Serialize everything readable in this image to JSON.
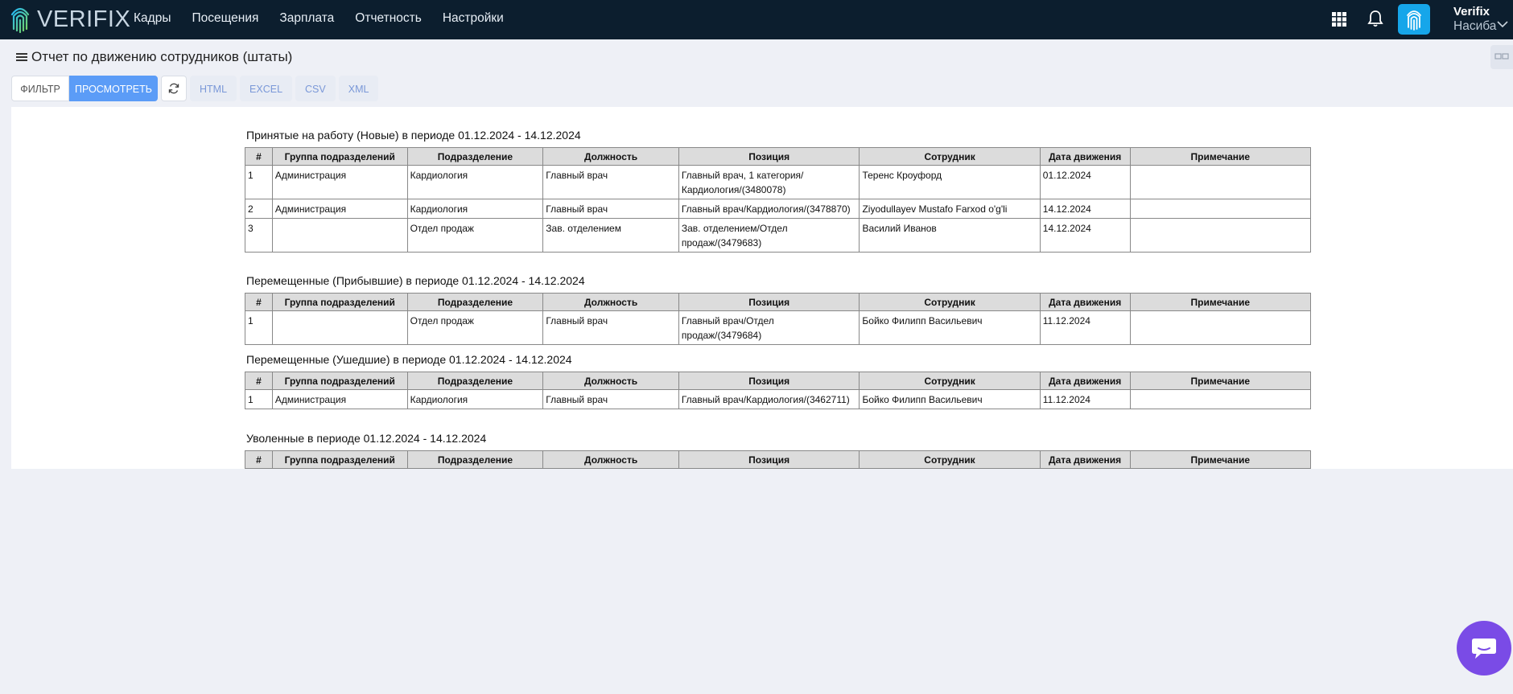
{
  "app": {
    "logo_text": "VERIFIX"
  },
  "nav": [
    {
      "label": "Кадры"
    },
    {
      "label": "Посещения"
    },
    {
      "label": "Зарплата"
    },
    {
      "label": "Отчетность"
    },
    {
      "label": "Настройки"
    }
  ],
  "user": {
    "company": "Verifix",
    "name": "Насиба"
  },
  "page": {
    "title": "Отчет по движению сотрудников (штаты)"
  },
  "toolbar": {
    "filter_label": "ФИЛЬТР",
    "view_label": "ПРОСМОТРЕТЬ",
    "formats": [
      "HTML",
      "EXCEL",
      "CSV",
      "XML"
    ]
  },
  "columns": [
    "#",
    "Группа подразделений",
    "Подразделение",
    "Должность",
    "Позиция",
    "Сотрудник",
    "Дата движения",
    "Примечание"
  ],
  "sections": [
    {
      "title": "Принятые на работу (Новые) в периоде 01.12.2024 - 14.12.2024",
      "rows": [
        [
          "1",
          "Администрация",
          "Кардиология",
          "Главный врач",
          "Главный врач, 1 категория/ Кардиология/(3480078)",
          "Теренс Кроуфорд",
          "01.12.2024",
          ""
        ],
        [
          "2",
          "Администрация",
          "Кардиология",
          "Главный врач",
          "Главный врач/Кардиология/(3478870)",
          "Ziyodullayev Mustafo Farxod o'g'li",
          "14.12.2024",
          ""
        ],
        [
          "3",
          "",
          "Отдел продаж",
          "Зав. отделением",
          "Зав. отделением/Отдел продаж/(3479683)",
          "Василий Иванов",
          "14.12.2024",
          ""
        ]
      ]
    },
    {
      "title": "Перемещенные (Прибывшие) в периоде 01.12.2024 - 14.12.2024",
      "rows": [
        [
          "1",
          "",
          "Отдел продаж",
          "Главный врач",
          "Главный врач/Отдел продаж/(3479684)",
          "Бойко Филипп Васильевич",
          "11.12.2024",
          ""
        ]
      ]
    },
    {
      "title": "Перемещенные (Ушедшие) в периоде 01.12.2024 - 14.12.2024",
      "rows": [
        [
          "1",
          "Администрация",
          "Кардиология",
          "Главный врач",
          "Главный врач/Кардиология/(3462711)",
          "Бойко Филипп Васильевич",
          "11.12.2024",
          ""
        ]
      ]
    },
    {
      "title": "Уволенные в периоде 01.12.2024 - 14.12.2024",
      "rows": []
    }
  ],
  "icons": {
    "apps": "apps-grid-icon",
    "notifications": "bell-icon",
    "fingerprint": "fingerprint-icon",
    "chat": "chat-icon"
  },
  "colors": {
    "topbar": "#0c1e2e",
    "accent": "#5b9cf7",
    "fingerprint_button": "#16a6ea",
    "chat_button": "#7a4be6",
    "page_bg": "#eef0f6"
  }
}
